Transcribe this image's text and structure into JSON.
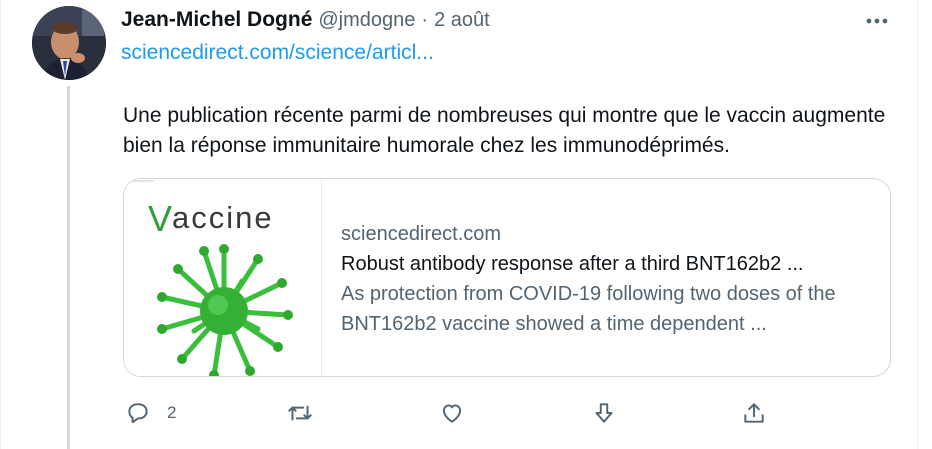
{
  "author": {
    "name": "Jean-Michel Dogné",
    "handle": "@jmdogne",
    "separator": "·",
    "date": "2 août"
  },
  "tweet": {
    "link_text": "sciencedirect.com/science/articl...",
    "text": "Une publication récente parmi de nombreuses qui montre que le vaccin augmente bien la réponse immunitaire humorale chez les immunodéprimés."
  },
  "card": {
    "thumb_logo": "Vaccine",
    "domain": "sciencedirect.com",
    "title": "Robust antibody response after a third BNT162b2 ...",
    "description": "As protection from COVID-19 following two doses of the BNT162b2 vaccine showed a time dependent ..."
  },
  "actions": {
    "reply_icon": "reply-icon",
    "reply_count": "2",
    "retweet_icon": "retweet-icon",
    "like_icon": "heart-icon",
    "vote_icon": "downvote-icon",
    "share_icon": "share-icon"
  },
  "colors": {
    "link": "#1d9bf0",
    "secondary_text": "#536471",
    "thread_line": "#cfd9de",
    "logo_green": "#2e9e3a"
  }
}
